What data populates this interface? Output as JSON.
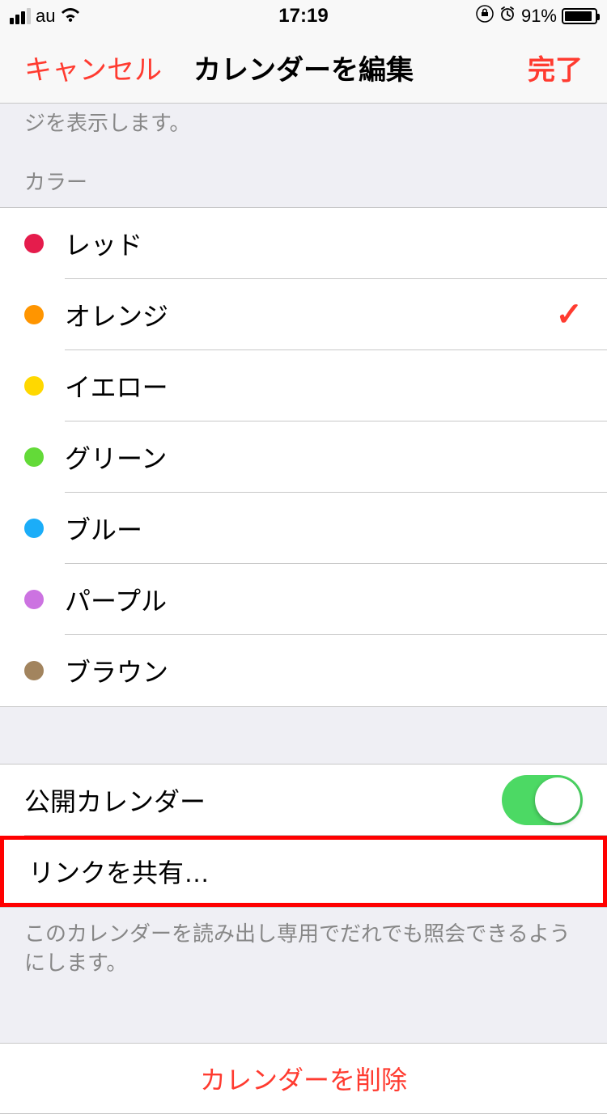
{
  "statusBar": {
    "carrier": "au",
    "time": "17:19",
    "battery": "91%"
  },
  "navBar": {
    "cancel": "キャンセル",
    "title": "カレンダーを編集",
    "done": "完了"
  },
  "partialFooter": "ジを表示します。",
  "colorSection": {
    "header": "カラー",
    "colors": [
      {
        "label": "レッド",
        "hex": "#e51c4c",
        "selected": false
      },
      {
        "label": "オレンジ",
        "hex": "#ff9500",
        "selected": true
      },
      {
        "label": "イエロー",
        "hex": "#ffd800",
        "selected": false
      },
      {
        "label": "グリーン",
        "hex": "#63da38",
        "selected": false
      },
      {
        "label": "ブルー",
        "hex": "#1badf8",
        "selected": false
      },
      {
        "label": "パープル",
        "hex": "#cc73e1",
        "selected": false
      },
      {
        "label": "ブラウン",
        "hex": "#a2845e",
        "selected": false
      }
    ]
  },
  "publicSection": {
    "publicCalendar": "公開カレンダー",
    "publicToggle": true,
    "shareLink": "リンクを共有…",
    "footer": "このカレンダーを読み出し専用でだれでも照会できるようにします。"
  },
  "delete": {
    "label": "カレンダーを削除"
  }
}
